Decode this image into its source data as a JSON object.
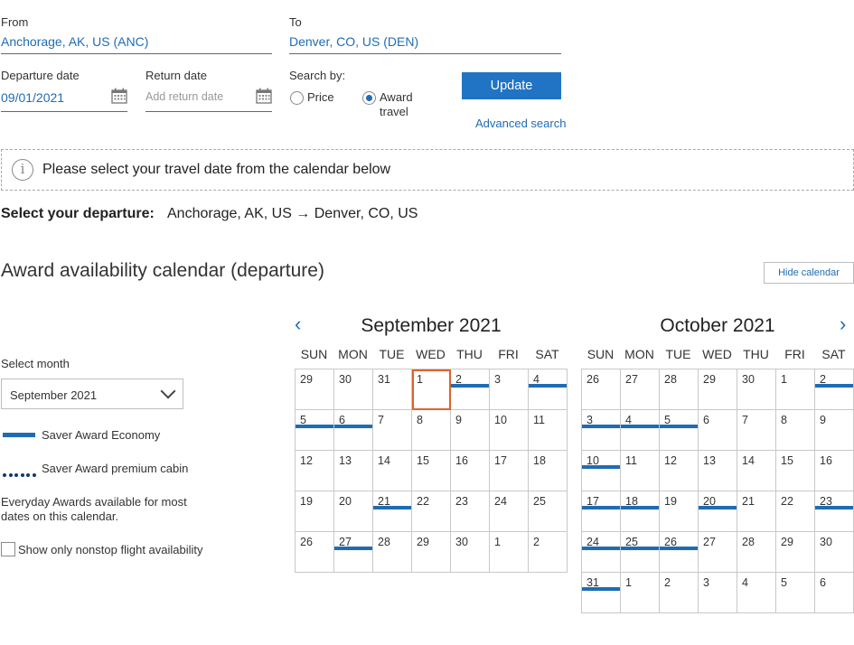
{
  "search": {
    "from_label": "From",
    "from_value": "Anchorage, AK, US (ANC)",
    "to_label": "To",
    "to_value": "Denver, CO, US (DEN)",
    "departure_label": "Departure date",
    "departure_value": "09/01/2021",
    "return_label": "Return date",
    "return_placeholder": "Add return date",
    "search_by_label": "Search by:",
    "option_price": "Price",
    "option_award_line1": "Award",
    "option_award_line2": "travel",
    "selected_option": "award",
    "update_label": "Update",
    "advanced_label": "Advanced search"
  },
  "notice": {
    "icon": "info-icon",
    "text": "Please select your travel date from the calendar below"
  },
  "route": {
    "label": "Select your departure:",
    "text": "Anchorage, AK, US → Denver, CO, US"
  },
  "calendar_section": {
    "title": "Award availability calendar (departure)",
    "hide_label": "Hide calendar"
  },
  "sidebar": {
    "select_month_label": "Select month",
    "selected_month": "September 2021",
    "legend_economy": "Saver Award Economy",
    "legend_premium": "Saver Award premium cabin",
    "everyday_note": "Everyday Awards available for most dates on this calendar.",
    "nonstop_label": "Show only nonstop flight availability",
    "nonstop_checked": false
  },
  "colors": {
    "accent": "#1f6cb4",
    "button": "#2173c3",
    "selected_outline": "#e0622b"
  },
  "days_of_week": [
    "SUN",
    "MON",
    "TUE",
    "WED",
    "THU",
    "FRI",
    "SAT"
  ],
  "months": [
    {
      "title": "September 2021",
      "nav": "prev",
      "weeks": [
        [
          {
            "d": "29"
          },
          {
            "d": "30"
          },
          {
            "d": "31"
          },
          {
            "d": "1",
            "selected": true
          },
          {
            "d": "2",
            "saver": true
          },
          {
            "d": "3"
          },
          {
            "d": "4",
            "saver": true
          }
        ],
        [
          {
            "d": "5",
            "saver": true
          },
          {
            "d": "6",
            "saver": true
          },
          {
            "d": "7"
          },
          {
            "d": "8"
          },
          {
            "d": "9"
          },
          {
            "d": "10"
          },
          {
            "d": "11"
          }
        ],
        [
          {
            "d": "12"
          },
          {
            "d": "13"
          },
          {
            "d": "14"
          },
          {
            "d": "15"
          },
          {
            "d": "16"
          },
          {
            "d": "17"
          },
          {
            "d": "18"
          }
        ],
        [
          {
            "d": "19"
          },
          {
            "d": "20"
          },
          {
            "d": "21",
            "saver": true
          },
          {
            "d": "22"
          },
          {
            "d": "23"
          },
          {
            "d": "24"
          },
          {
            "d": "25"
          }
        ],
        [
          {
            "d": "26"
          },
          {
            "d": "27",
            "saver": true
          },
          {
            "d": "28"
          },
          {
            "d": "29"
          },
          {
            "d": "30"
          },
          {
            "d": "1"
          },
          {
            "d": "2"
          }
        ]
      ]
    },
    {
      "title": "October 2021",
      "nav": "next",
      "weeks": [
        [
          {
            "d": "26"
          },
          {
            "d": "27"
          },
          {
            "d": "28"
          },
          {
            "d": "29"
          },
          {
            "d": "30"
          },
          {
            "d": "1"
          },
          {
            "d": "2",
            "saver": true
          }
        ],
        [
          {
            "d": "3",
            "saver": true
          },
          {
            "d": "4",
            "saver": true
          },
          {
            "d": "5",
            "saver": true
          },
          {
            "d": "6"
          },
          {
            "d": "7"
          },
          {
            "d": "8"
          },
          {
            "d": "9"
          }
        ],
        [
          {
            "d": "10",
            "saver": true
          },
          {
            "d": "11"
          },
          {
            "d": "12"
          },
          {
            "d": "13"
          },
          {
            "d": "14"
          },
          {
            "d": "15"
          },
          {
            "d": "16"
          }
        ],
        [
          {
            "d": "17",
            "saver": true
          },
          {
            "d": "18",
            "saver": true
          },
          {
            "d": "19"
          },
          {
            "d": "20",
            "saver": true
          },
          {
            "d": "21"
          },
          {
            "d": "22"
          },
          {
            "d": "23",
            "saver": true
          }
        ],
        [
          {
            "d": "24",
            "saver": true
          },
          {
            "d": "25",
            "saver": true
          },
          {
            "d": "26",
            "saver": true
          },
          {
            "d": "27"
          },
          {
            "d": "28"
          },
          {
            "d": "29"
          },
          {
            "d": "30"
          }
        ],
        [
          {
            "d": "31",
            "saver": true
          },
          {
            "d": "1"
          },
          {
            "d": "2"
          },
          {
            "d": "3"
          },
          {
            "d": "4"
          },
          {
            "d": "5"
          },
          {
            "d": "6"
          }
        ]
      ]
    }
  ]
}
